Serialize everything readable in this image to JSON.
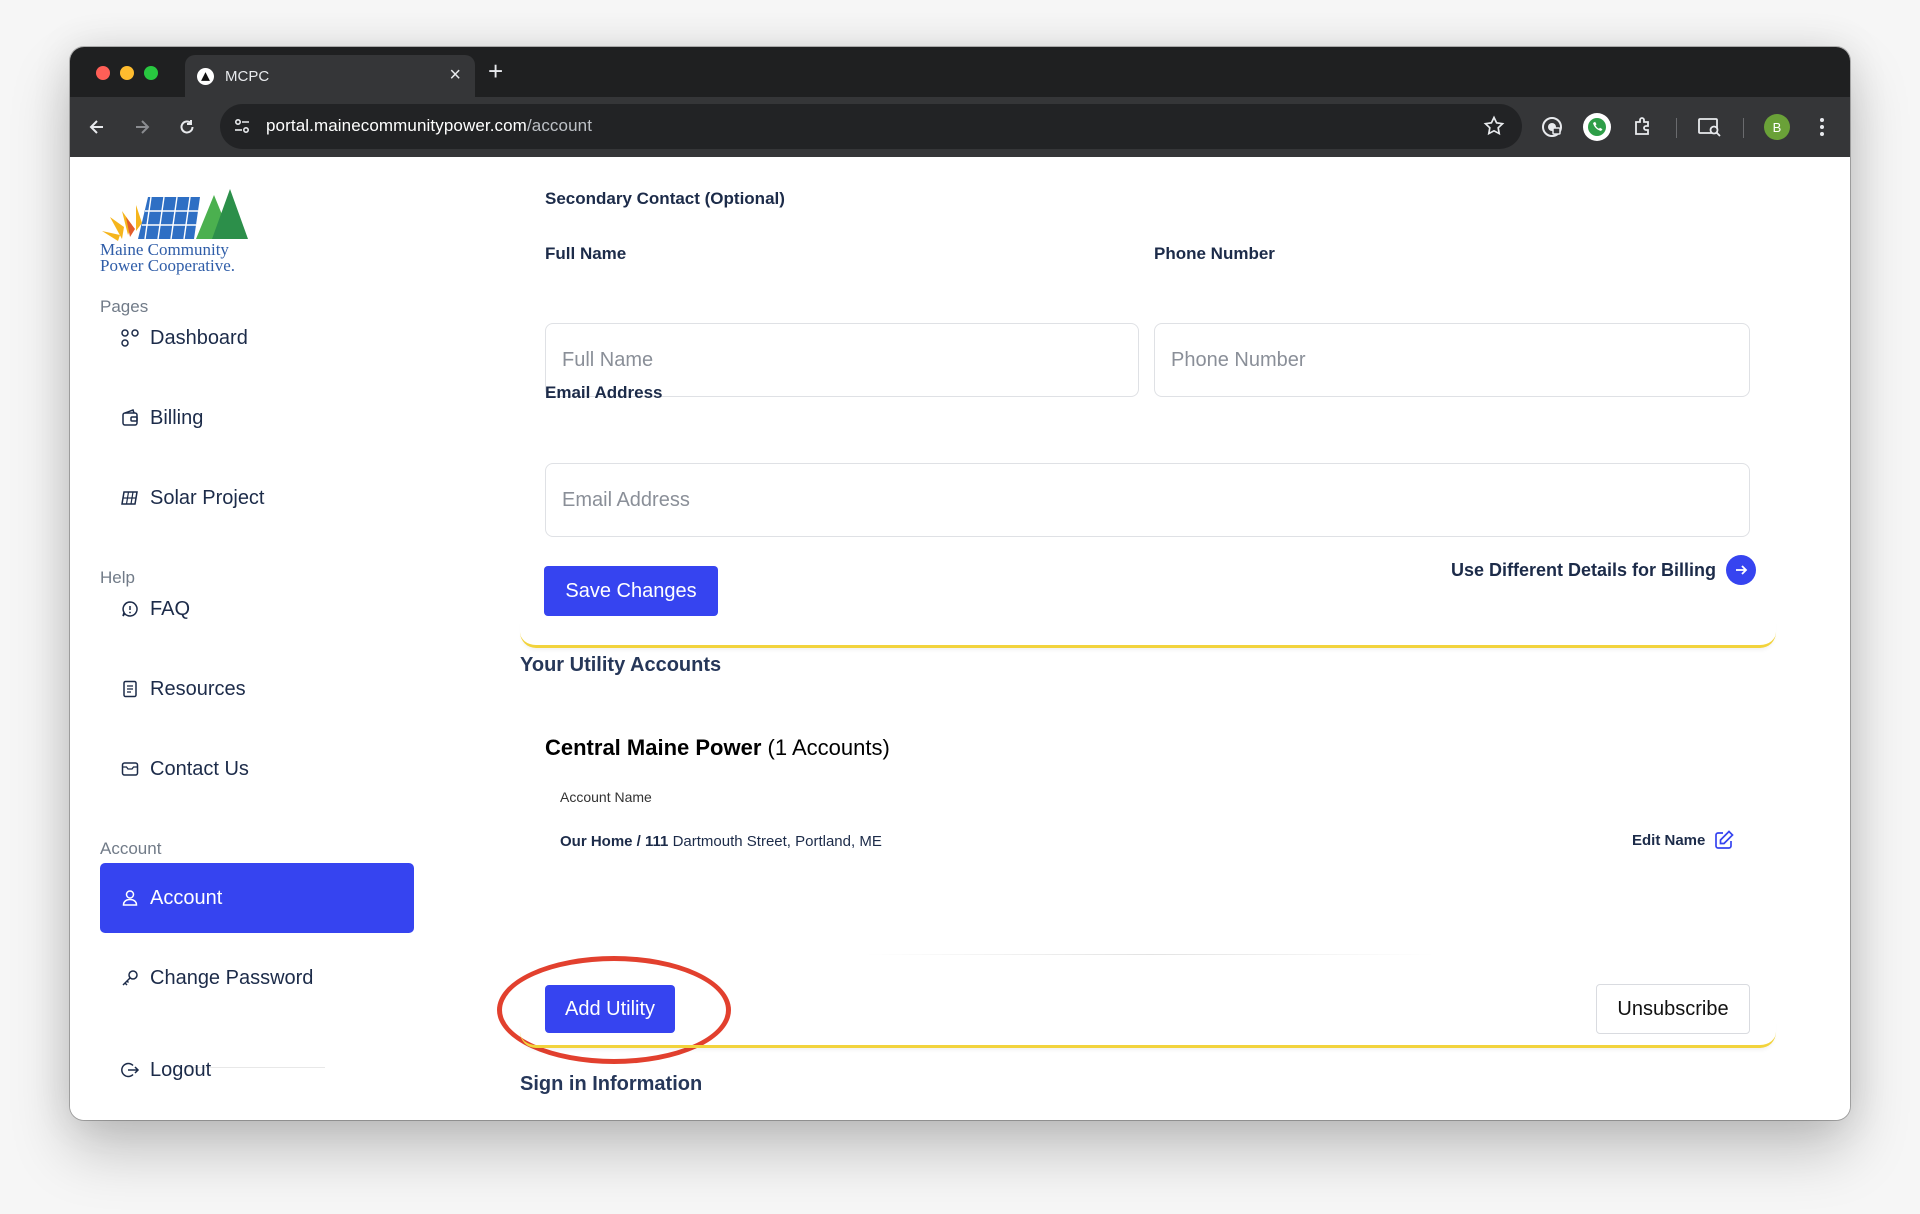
{
  "browser": {
    "tab_title": "MCPC",
    "url_host": "portal.mainecommunitypower.com",
    "url_path": "/account",
    "profile_initial": "B"
  },
  "logo": {
    "line1": "Maine Community",
    "line2": "Power Cooperative."
  },
  "sidebar": {
    "pages_label": "Pages",
    "help_label": "Help",
    "account_label": "Account",
    "items": {
      "dashboard": "Dashboard",
      "billing": "Billing",
      "solar_project": "Solar Project",
      "faq": "FAQ",
      "resources": "Resources",
      "contact_us": "Contact Us",
      "account": "Account",
      "change_password": "Change Password",
      "logout": "Logout"
    }
  },
  "secondary_contact": {
    "heading": "Secondary Contact (Optional)",
    "full_name_label": "Full Name",
    "full_name_placeholder": "Full Name",
    "phone_label": "Phone Number",
    "phone_placeholder": "Phone Number",
    "email_label": "Email Address",
    "email_placeholder": "Email Address",
    "save_button": "Save Changes",
    "billing_link": "Use Different Details for Billing"
  },
  "utility_accounts": {
    "heading": "Your Utility Accounts",
    "provider_name": "Central Maine Power",
    "provider_count": "(1 Accounts)",
    "column_label": "Account Name",
    "account_name": "Our Home /",
    "account_number": "111",
    "account_address": "Dartmouth Street, Portland, ME",
    "edit_name": "Edit Name",
    "add_button": "Add Utility",
    "unsubscribe_button": "Unsubscribe"
  },
  "sign_in": {
    "heading": "Sign in Information"
  },
  "colors": {
    "accent": "#3644f0",
    "card_border": "#f2d33c",
    "annotation": "#e2402e",
    "text_dark": "#1c2b49"
  }
}
